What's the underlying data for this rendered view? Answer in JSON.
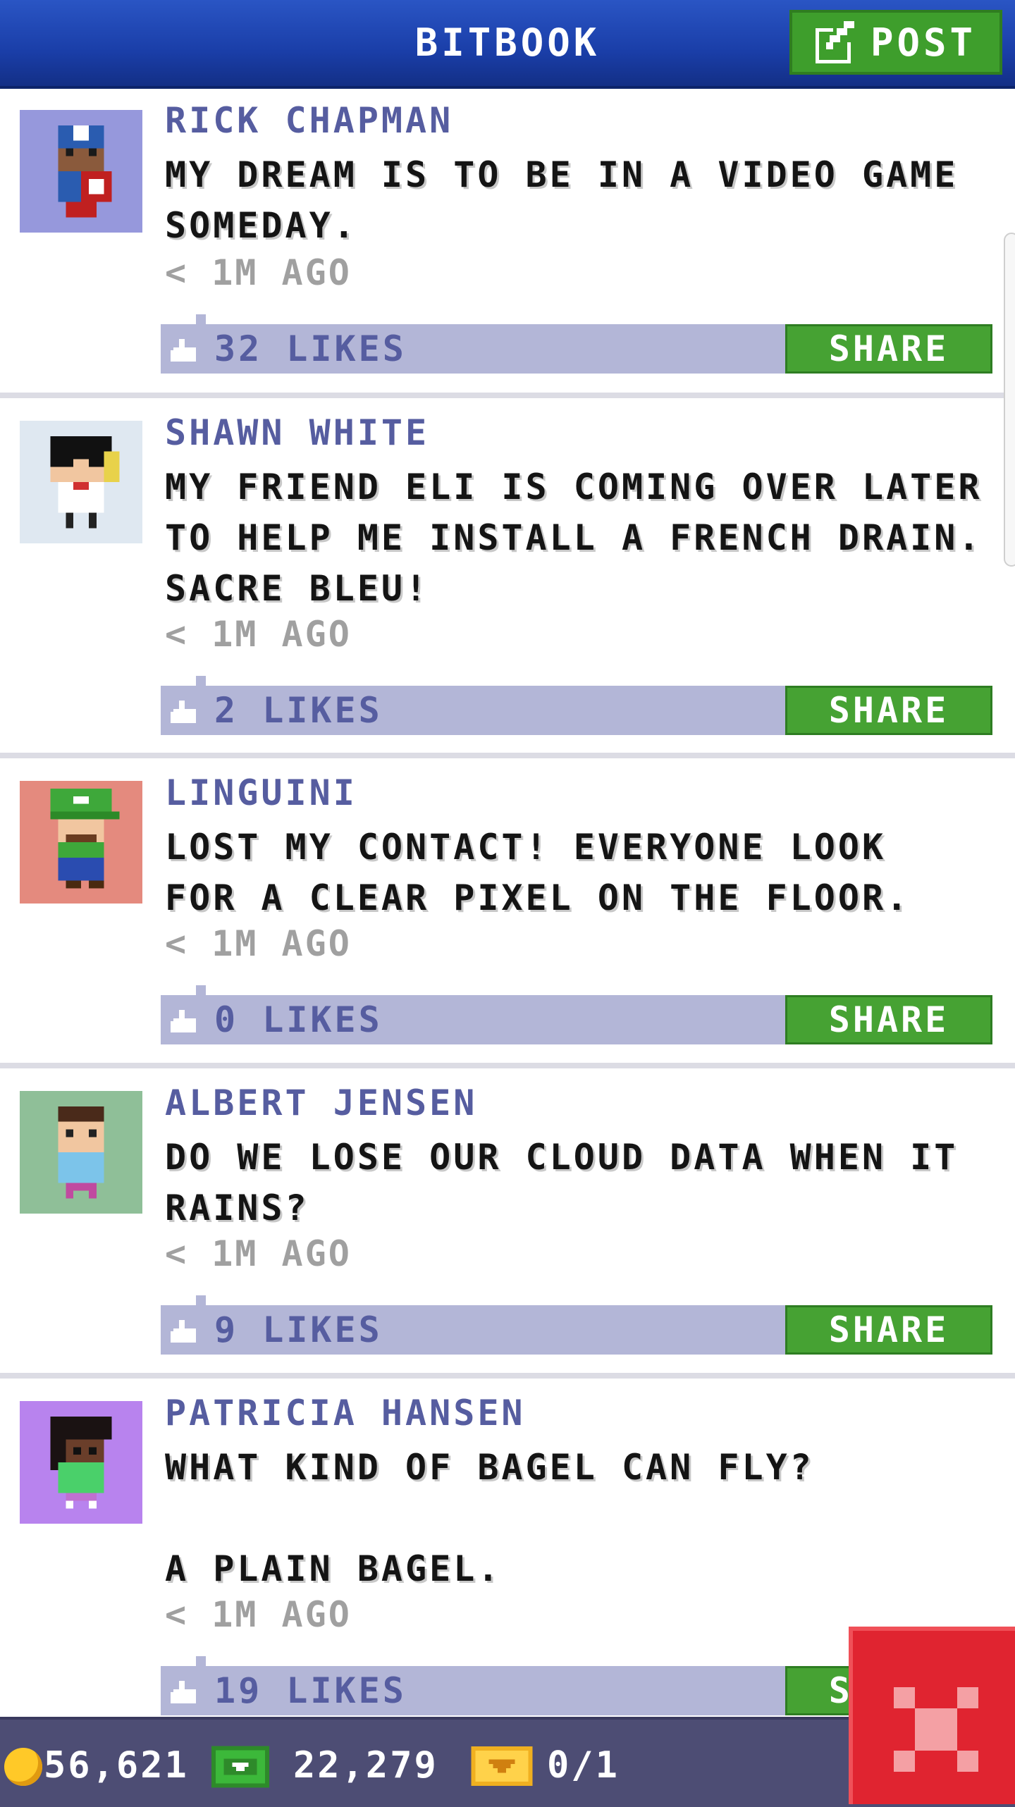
{
  "header": {
    "title": "BITBOOK",
    "post_label": "POST"
  },
  "posts": [
    {
      "author": "RICK CHAPMAN",
      "message": "MY DREAM IS TO BE IN A VIDEO GAME\nSOMEDAY.",
      "time": "< 1M AGO",
      "likes": "32 LIKES",
      "share": "SHARE",
      "avatar_color": "#9698dc"
    },
    {
      "author": "SHAWN WHITE",
      "message": "MY FRIEND ELI IS COMING OVER LATER\nTO HELP ME INSTALL A FRENCH DRAIN.\nSACRE BLEU!",
      "time": "< 1M AGO",
      "likes": "2 LIKES",
      "share": "SHARE",
      "avatar_color": "#dfe8f1"
    },
    {
      "author": "LINGUINI",
      "message": "LOST MY CONTACT! EVERYONE LOOK\nFOR A CLEAR PIXEL ON THE FLOOR.",
      "time": "< 1M AGO",
      "likes": "0 LIKES",
      "share": "SHARE",
      "avatar_color": "#e48a7e"
    },
    {
      "author": "ALBERT JENSEN",
      "message": "DO WE LOSE OUR CLOUD DATA WHEN IT\nRAINS?",
      "time": "< 1M AGO",
      "likes": "9 LIKES",
      "share": "SHARE",
      "avatar_color": "#8fbf98"
    },
    {
      "author": "PATRICIA HANSEN",
      "message": "WHAT KIND OF BAGEL CAN FLY?\n\nA PLAIN BAGEL.",
      "time": "< 1M AGO",
      "likes": "19 LIKES",
      "share": "SHARE",
      "avatar_color": "#b883ee"
    }
  ],
  "bottom_bar": {
    "coins": "56,621",
    "bux": "22,279",
    "tickets": "0/1"
  },
  "colors": {
    "header_blue": "#1a3ea8",
    "action_green": "#46a233",
    "like_bar": "#b3b6d7",
    "name_purple": "#565da0",
    "close_red": "#e02430"
  },
  "icons": {
    "post": "compose-icon",
    "like": "thumbs-up-icon",
    "coin": "coin-icon",
    "bux": "bux-icon",
    "ticket": "ticket-icon",
    "close": "close-icon"
  }
}
